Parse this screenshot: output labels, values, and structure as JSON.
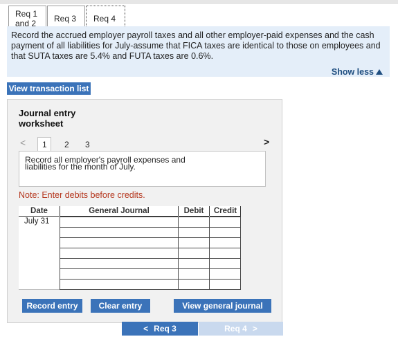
{
  "tabs": [
    {
      "label_line1": "Req 1",
      "label_line2": "and 2"
    },
    {
      "label": "Req 3"
    },
    {
      "label": "Req 4"
    }
  ],
  "instructions": "Record the accrued employer payroll taxes and all other employer-paid expenses and the cash payment of all liabilities for July-assume that FICA taxes are identical to those on employees and that SUTA taxes are 5.4% and FUTA taxes are 0.6%.",
  "show_less_label": "Show less",
  "view_transactions_label": "View transaction list",
  "worksheet": {
    "title_line1": "Journal entry",
    "title_line2": "worksheet",
    "prev_arrow": "<",
    "next_arrow": ">",
    "pages": [
      "1",
      "2",
      "3"
    ],
    "current_page": "1",
    "description_line1": "Record all employer's payroll expenses and",
    "description_line2": "liabilities for the month of July.",
    "note": "Note: Enter debits before credits.",
    "headers": {
      "date": "Date",
      "general_journal": "General Journal",
      "debit": "Debit",
      "credit": "Credit"
    },
    "rows": [
      {
        "date": "July 31",
        "account": "",
        "debit": "",
        "credit": ""
      },
      {
        "date": "",
        "account": "",
        "debit": "",
        "credit": ""
      },
      {
        "date": "",
        "account": "",
        "debit": "",
        "credit": ""
      },
      {
        "date": "",
        "account": "",
        "debit": "",
        "credit": ""
      },
      {
        "date": "",
        "account": "",
        "debit": "",
        "credit": ""
      },
      {
        "date": "",
        "account": "",
        "debit": "",
        "credit": ""
      },
      {
        "date": "",
        "account": "",
        "debit": "",
        "credit": ""
      }
    ],
    "buttons": {
      "record": "Record entry",
      "clear": "Clear entry",
      "view_journal": "View general journal"
    }
  },
  "nav": {
    "prev_label": "Req 3",
    "next_label": "Req 4",
    "prev_glyph": "<",
    "next_glyph": ">"
  },
  "colors": {
    "accent": "#3b73b9",
    "instructions_bg": "#e4eef9",
    "note": "#b5361d",
    "disabled": "#c9d9ee"
  }
}
